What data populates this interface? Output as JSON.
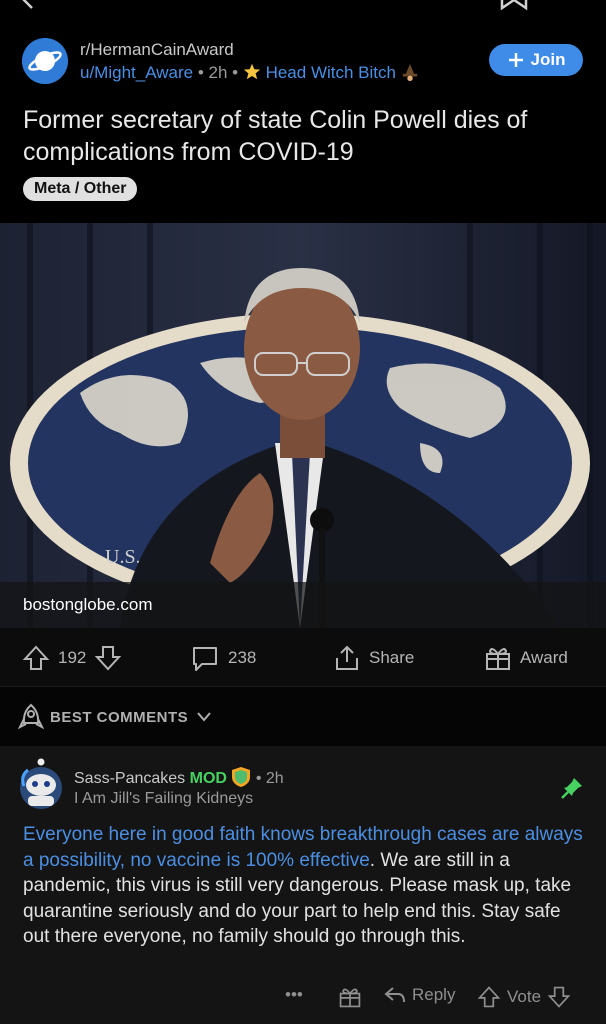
{
  "subreddit": {
    "name": "r/HermanCainAward"
  },
  "post": {
    "author": "u/Might_Aware",
    "age": "2h",
    "author_flair": "Head Witch Bitch",
    "join_label": "Join",
    "title": "Former secretary of state Colin Powell dies of complications from COVID-19",
    "tag": "Meta / Other",
    "link_domain": "bostonglobe.com",
    "image_seal_text": "U.S.",
    "upvotes": "192",
    "comments": "238",
    "share_label": "Share",
    "award_label": "Award"
  },
  "sort": {
    "label": "BEST COMMENTS"
  },
  "comment": {
    "author": "Sass-Pancakes",
    "mod_badge": "MOD",
    "age": "2h",
    "flair": "I Am Jill's Failing Kidneys",
    "body_highlight": "Everyone here in good faith knows breakthrough cases are always a possibility, no vaccine is 100% effective",
    "body_rest": ". We are still in a pandemic, this virus is still very dangerous. Please mask up, take quarantine seriously and do your part to help end this. Stay safe out there everyone, no family should go through this.",
    "more_label": "•••",
    "reply_label": "Reply",
    "vote_label": "Vote"
  },
  "colors": {
    "accent": "#3e8be8",
    "link": "#4b8fe3",
    "mod": "#46d160",
    "background": "#000000"
  }
}
